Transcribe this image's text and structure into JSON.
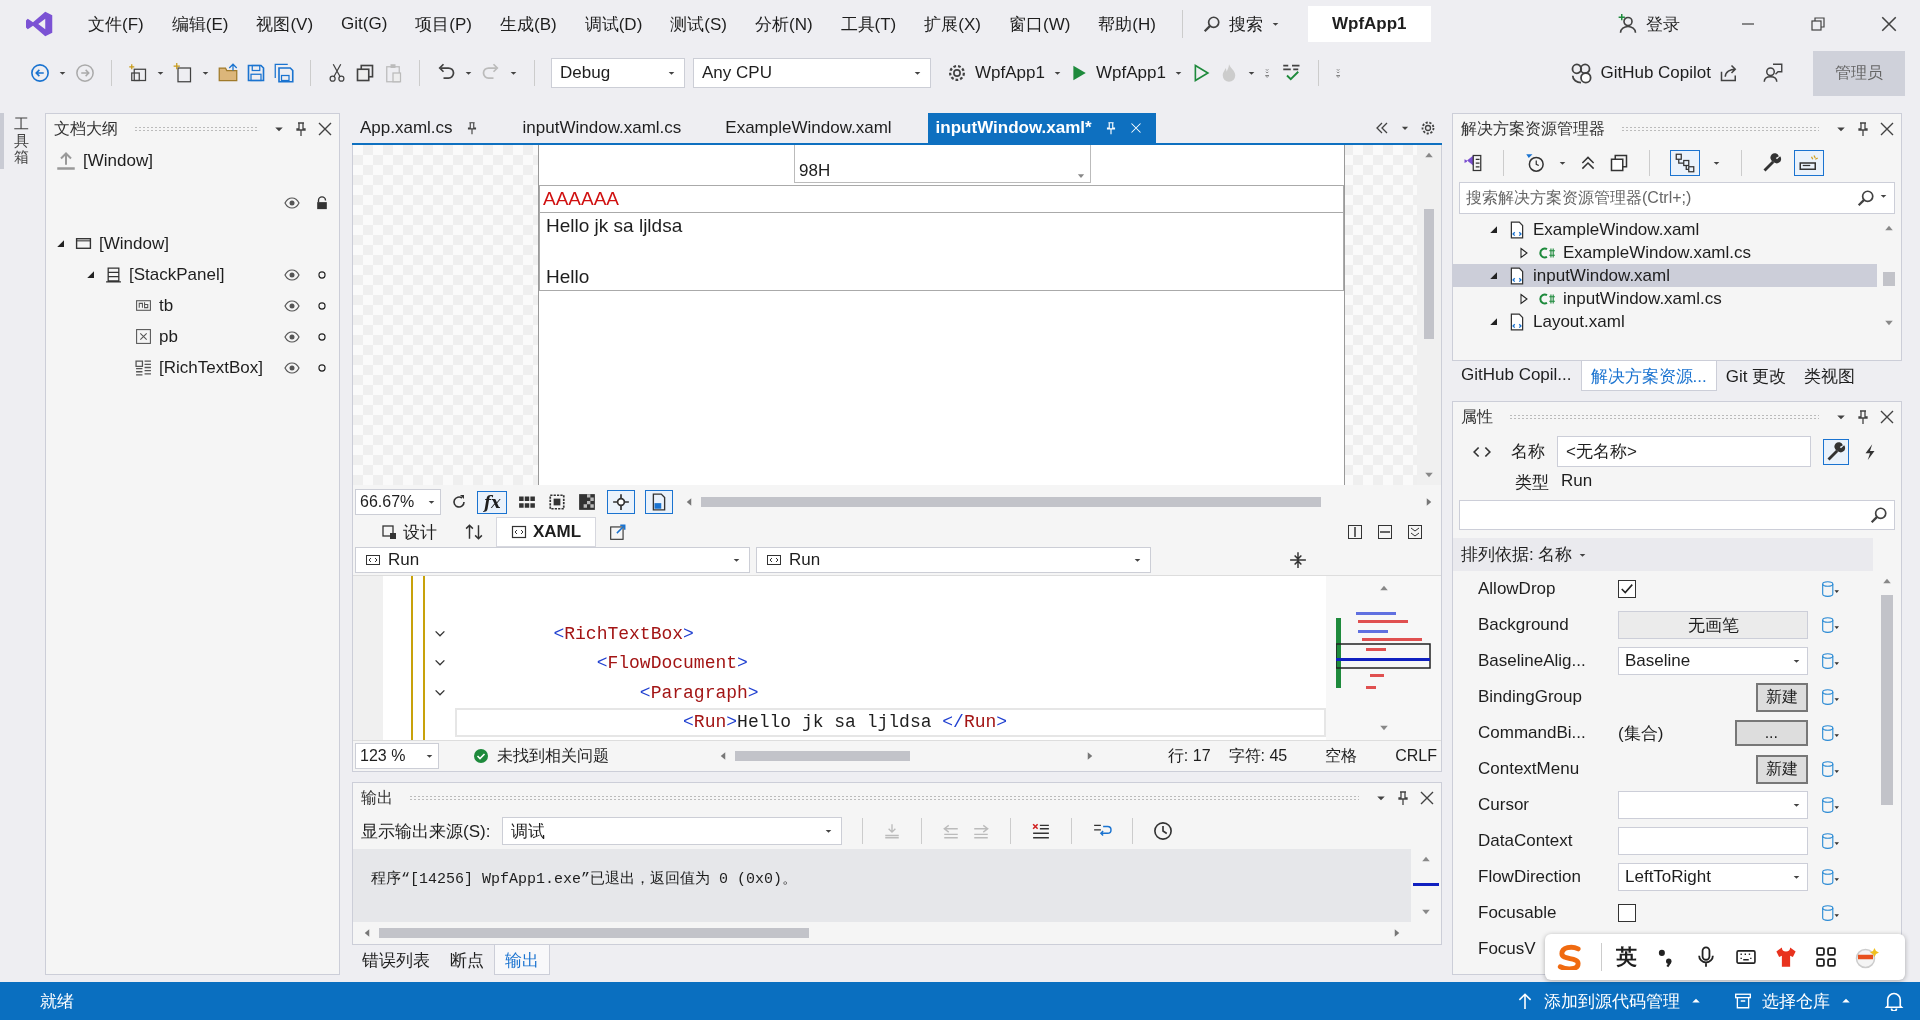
{
  "title_bar": {
    "search": "搜索",
    "app_title": "WpfApp1",
    "sign_in": "登录"
  },
  "menu": [
    "文件(F)",
    "编辑(E)",
    "视图(V)",
    "Git(G)",
    "项目(P)",
    "生成(B)",
    "调试(D)",
    "测试(S)",
    "分析(N)",
    "工具(T)",
    "扩展(X)",
    "窗口(W)",
    "帮助(H)"
  ],
  "toolbar": {
    "configuration": "Debug",
    "platform": "Any CPU",
    "startup_project": "WpfApp1",
    "run_target": "WpfApp1",
    "copilot": "GitHub Copilot",
    "admin_badge": "管理员"
  },
  "toolbox_strip": "工具箱",
  "document_outline": {
    "title": "文档大纲",
    "root": "[Window]",
    "tree": [
      {
        "label": "[Window]",
        "kind": "window",
        "expanded": true,
        "children": [
          {
            "label": "[StackPanel]",
            "kind": "stackpanel",
            "expanded": true,
            "children": [
              {
                "label": "tb",
                "kind": "textblock"
              },
              {
                "label": "pb",
                "kind": "progressbar"
              },
              {
                "label": "[RichTextBox]",
                "kind": "richtextbox"
              }
            ]
          }
        ]
      }
    ]
  },
  "editor_tabs": [
    {
      "label": "App.xaml.cs",
      "pinned": true,
      "selected": false
    },
    {
      "label": "inputWindow.xaml.cs",
      "pinned": false,
      "selected": false
    },
    {
      "label": "ExampleWindow.xaml",
      "pinned": false,
      "selected": false
    },
    {
      "label": "inputWindow.xaml*",
      "pinned": true,
      "selected": true
    }
  ],
  "designer": {
    "textbox_text": "98H",
    "red_text": "AAAAAA",
    "rich_text_paragraphs": [
      "Hello jk sa ljldsa",
      "Hello"
    ],
    "zoom": "66.67%",
    "formula_button": "fx"
  },
  "view_tabs": [
    {
      "label": "设计",
      "selected": false
    },
    {
      "label": "XAML",
      "selected": true
    }
  ],
  "member_dropdowns": [
    "Run",
    "Run"
  ],
  "code_lines": [
    {
      "kind": "blank",
      "foldable": false,
      "current": false
    },
    {
      "kind": "code",
      "text": "        <RichTextBox>",
      "foldable": true,
      "current": false
    },
    {
      "kind": "code",
      "text": "            <FlowDocument>",
      "foldable": true,
      "current": false
    },
    {
      "kind": "code",
      "text": "                <Paragraph>",
      "foldable": true,
      "current": false
    },
    {
      "kind": "code",
      "text": "                    <Run>Hello jk sa ljldsa </Run>",
      "foldable": false,
      "current": true
    }
  ],
  "editor_status": {
    "zoom": "123 %",
    "issues": "未找到相关问题",
    "line": "行: 17",
    "char": "字符: 45",
    "spacing": "空格",
    "line_ending": "CRLF"
  },
  "output": {
    "title": "输出",
    "source_label": "显示输出来源(S):",
    "source": "调试",
    "lines": [
      "程序“[14256] WpfApp1.exe”已退出，返回值为 0 (0x0)。"
    ]
  },
  "bottom_tabs": [
    {
      "label": "错误列表",
      "selected": false
    },
    {
      "label": "断点",
      "selected": false
    },
    {
      "label": "输出",
      "selected": true
    }
  ],
  "solution_explorer": {
    "title": "解决方案资源管理器",
    "search_placeholder": "搜索解决方案资源管理器(Ctrl+;)",
    "tree": [
      {
        "label": "ExampleWindow.xaml",
        "kind": "xaml",
        "expanded": true,
        "selected": false,
        "children": [
          {
            "label": "ExampleWindow.xaml.cs",
            "kind": "csharp",
            "expanded": false,
            "selected": false
          }
        ]
      },
      {
        "label": "inputWindow.xaml",
        "kind": "xaml",
        "expanded": true,
        "selected": true,
        "children": [
          {
            "label": "inputWindow.xaml.cs",
            "kind": "csharp",
            "expanded": false,
            "selected": false
          }
        ]
      },
      {
        "label": "Layout.xaml",
        "kind": "xaml",
        "expanded": true,
        "selected": false
      }
    ]
  },
  "right_tabs": [
    {
      "label": "GitHub Copil...",
      "selected": false
    },
    {
      "label": "解决方案资源...",
      "selected": true
    },
    {
      "label": "Git 更改",
      "selected": false
    },
    {
      "label": "类视图",
      "selected": false
    }
  ],
  "properties": {
    "title": "属性",
    "name_label": "名称",
    "name_value": "<无名称>",
    "type_label": "类型",
    "type_value": "Run",
    "sort_label": "排列依据: 名称",
    "rows": [
      {
        "name": "AllowDrop",
        "kind": "checkbox",
        "checked": true
      },
      {
        "name": "Background",
        "kind": "brush",
        "value": "无画笔"
      },
      {
        "name": "BaselineAlig...",
        "kind": "dropdown",
        "value": "Baseline"
      },
      {
        "name": "BindingGroup",
        "kind": "new",
        "button_label": "新建"
      },
      {
        "name": "CommandBi...",
        "kind": "collection",
        "value": "(集合)",
        "button_label": "..."
      },
      {
        "name": "ContextMenu",
        "kind": "new",
        "button_label": "新建"
      },
      {
        "name": "Cursor",
        "kind": "dropdown"
      },
      {
        "name": "DataContext",
        "kind": "text"
      },
      {
        "name": "FlowDirection",
        "kind": "dropdown",
        "value": "LeftToRight"
      },
      {
        "name": "Focusable",
        "kind": "checkbox",
        "checked": false
      },
      {
        "name": "FocusV",
        "kind": "covered"
      }
    ]
  },
  "status_bar": {
    "state": "就绪",
    "source_control": "添加到源代码管理",
    "repository": "选择仓库"
  },
  "ime_toolbar": {
    "language": "英"
  }
}
